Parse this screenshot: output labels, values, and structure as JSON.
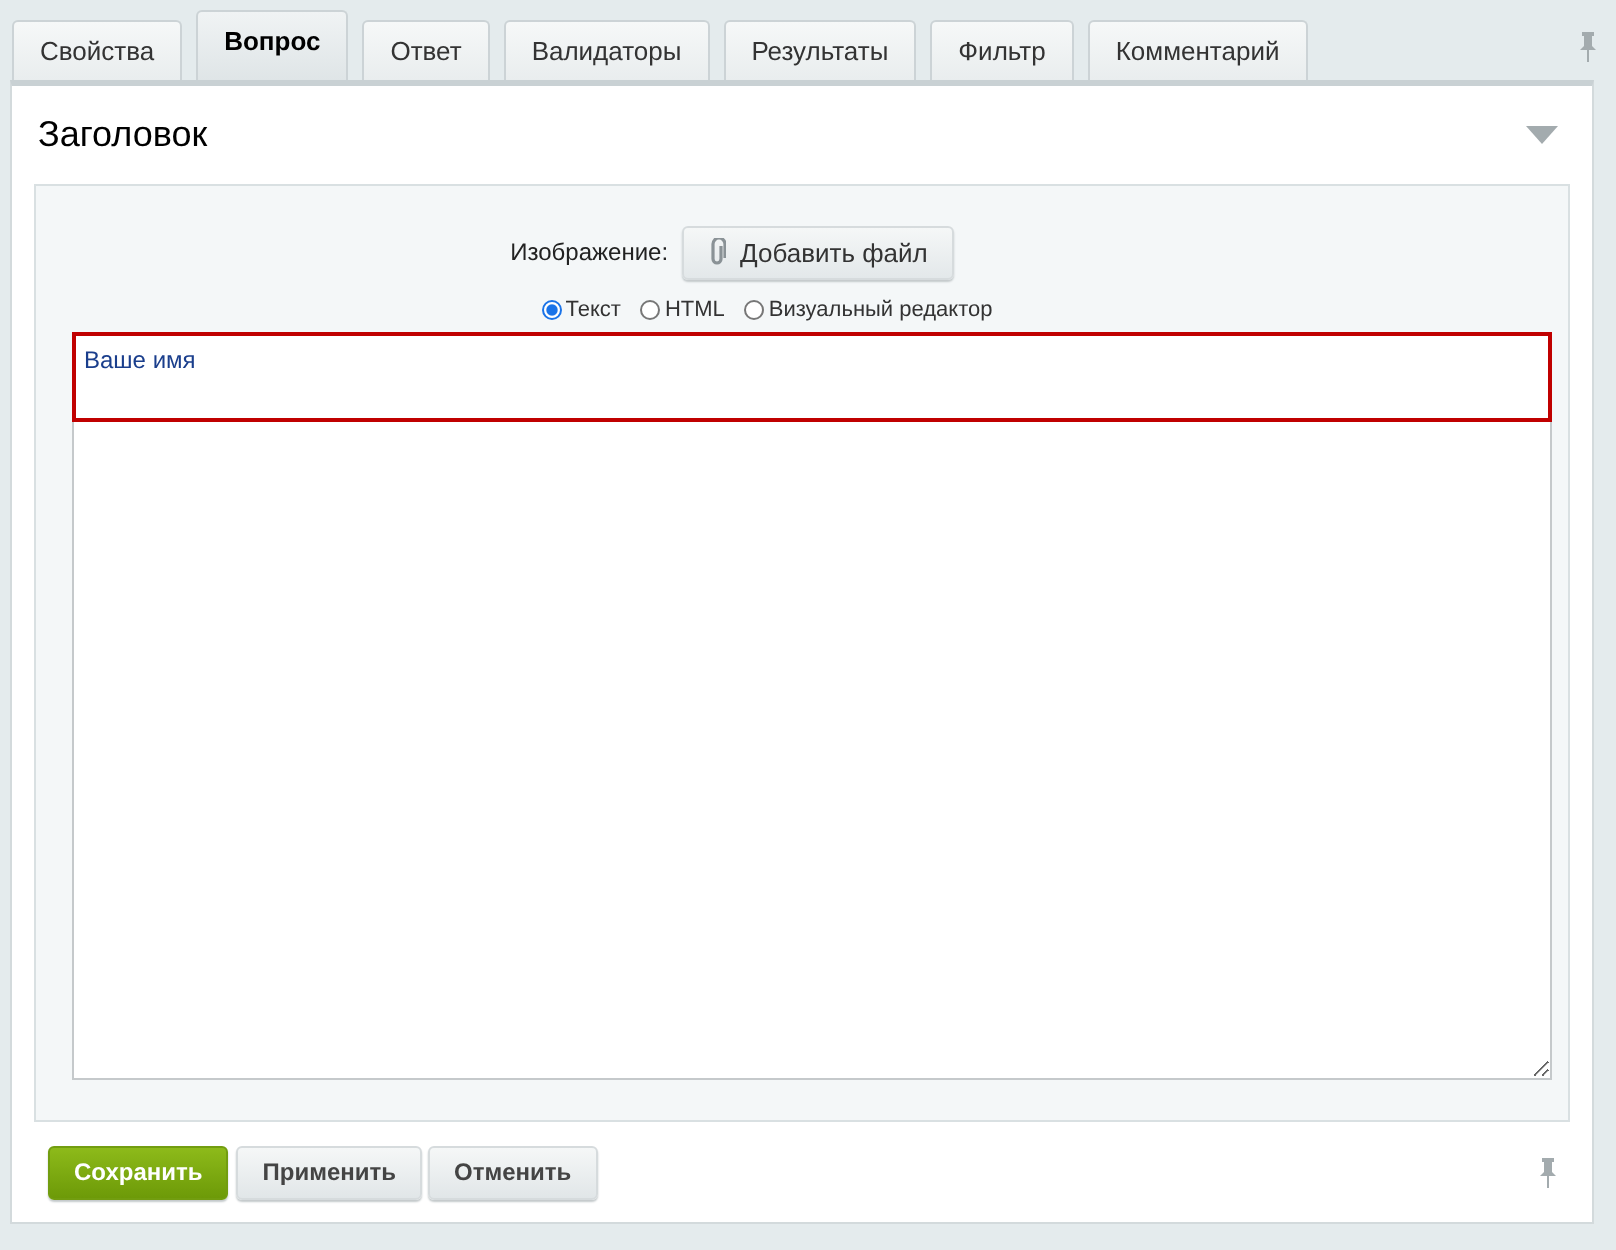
{
  "tabs": [
    {
      "label": "Свойства",
      "selected": false
    },
    {
      "label": "Вопрос",
      "selected": true
    },
    {
      "label": "Ответ",
      "selected": false
    },
    {
      "label": "Валидаторы",
      "selected": false
    },
    {
      "label": "Результаты",
      "selected": false
    },
    {
      "label": "Фильтр",
      "selected": false
    },
    {
      "label": "Комментарий",
      "selected": false
    }
  ],
  "section": {
    "title": "Заголовок",
    "expanded": true
  },
  "image": {
    "label": "Изображение:",
    "button": "Добавить файл"
  },
  "formats": [
    {
      "label": "Текст",
      "selected": true
    },
    {
      "label": "HTML",
      "selected": false
    },
    {
      "label": "Визуальный редактор",
      "selected": false
    }
  ],
  "editor": {
    "value": "Ваше имя",
    "highlighted": true
  },
  "buttons": [
    {
      "label": "Сохранить",
      "kind": "primary"
    },
    {
      "label": "Применить",
      "kind": "default"
    },
    {
      "label": "Отменить",
      "kind": "default"
    }
  ]
}
